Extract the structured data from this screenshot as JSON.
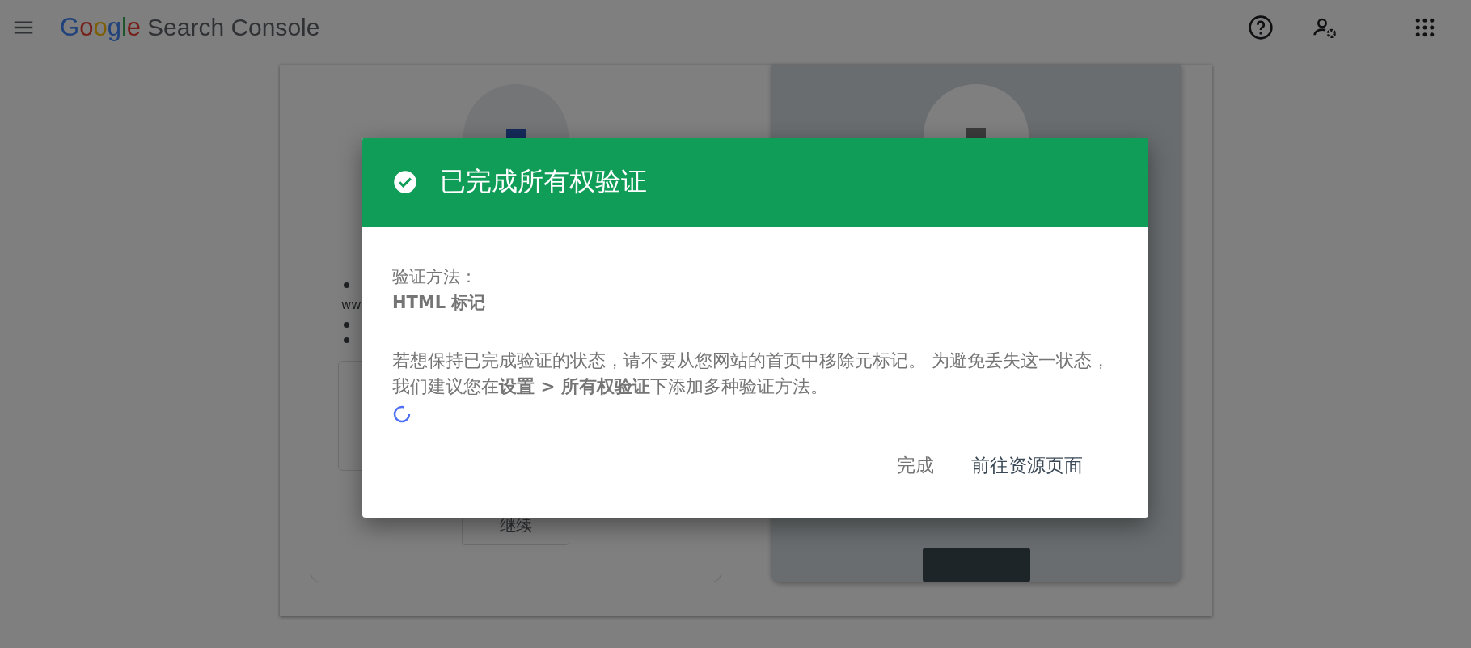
{
  "header": {
    "logo": "Google",
    "product": "Search Console"
  },
  "background": {
    "left_card": {
      "fragment": "ww",
      "button": "继续"
    },
    "right_card": {
      "selected": true
    }
  },
  "dialog": {
    "title": "已完成所有权验证",
    "verified": true,
    "method_label": "验证方法：",
    "method": "HTML 标记",
    "message": "若想保持已完成验证的状态，请不要从您网站的首页中移除元标记。 为避免丢失这一状态，我们建议您在**设置 > 所有权验证**下添加多种验证方法。",
    "loading": true,
    "buttons": [
      {
        "label": "完成",
        "kind": "secondary"
      },
      {
        "label": "前往资源页面",
        "kind": "primary"
      }
    ]
  }
}
